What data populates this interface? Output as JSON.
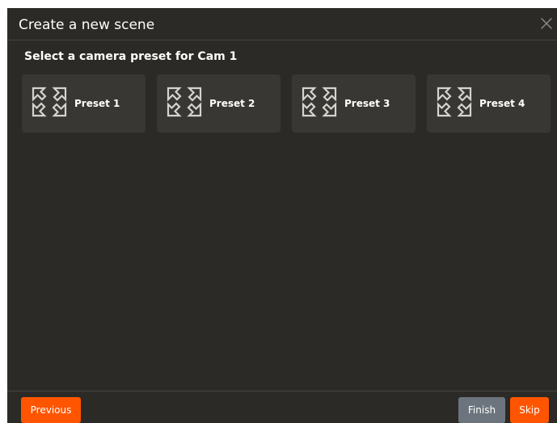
{
  "dialog": {
    "title": "Create a new scene",
    "close_icon": "close-icon",
    "subtitle": "Select a camera preset for Cam 1"
  },
  "presets": [
    {
      "label": "Preset 1",
      "icon": "expand-arrows-icon"
    },
    {
      "label": "Preset 2",
      "icon": "expand-arrows-icon"
    },
    {
      "label": "Preset 3",
      "icon": "expand-arrows-icon"
    },
    {
      "label": "Preset 4",
      "icon": "expand-arrows-icon"
    }
  ],
  "footer": {
    "previous_label": "Previous",
    "finish_label": "Finish",
    "skip_label": "Skip"
  },
  "colors": {
    "dialog_background": "#2b2a26",
    "card_background": "#383733",
    "accent": "#ff5500",
    "secondary_button": "#6c757d",
    "text": "#ffffff"
  }
}
